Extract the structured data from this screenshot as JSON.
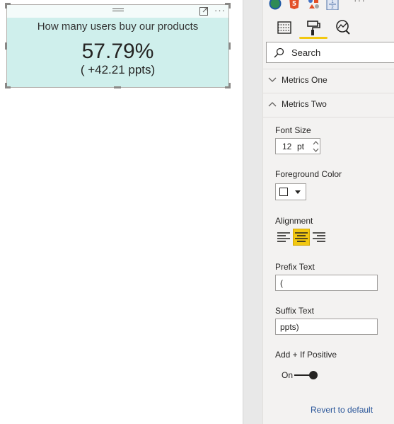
{
  "visual": {
    "title": "How many users buy our products",
    "value": "57.79%",
    "subvalue": "( +42.21 ppts)",
    "background_color": "#cfefec",
    "header_icons": [
      "drag-handle-icon",
      "focus-mode-icon",
      "more-options-icon"
    ]
  },
  "pane": {
    "visual_icons": [
      "globe-map-icon",
      "html5-icon",
      "shapes-icon",
      "list-icon",
      "more-options-icon"
    ],
    "tabs": [
      "fields-tab",
      "format-tab",
      "analytics-tab"
    ],
    "active_tab": "format-tab",
    "search": {
      "placeholder": "Search"
    },
    "sections": {
      "metrics_one": {
        "label": "Metrics One",
        "expanded": false
      },
      "metrics_two": {
        "label": "Metrics Two",
        "expanded": true
      }
    },
    "font_size": {
      "label": "Font Size",
      "value": "12",
      "unit": "pt"
    },
    "foreground_color": {
      "label": "Foreground Color",
      "value": "#ffffff"
    },
    "alignment": {
      "label": "Alignment",
      "options": [
        "left",
        "center",
        "right"
      ],
      "selected": "center"
    },
    "prefix_text": {
      "label": "Prefix Text",
      "value": "("
    },
    "suffix_text": {
      "label": "Suffix Text",
      "value": "ppts)"
    },
    "add_plus_if_positive": {
      "label": "Add + If Positive",
      "state_label": "On",
      "enabled": true
    },
    "revert_label": "Revert to default",
    "accent_color": "#f2c811",
    "link_color": "#2b579a"
  }
}
